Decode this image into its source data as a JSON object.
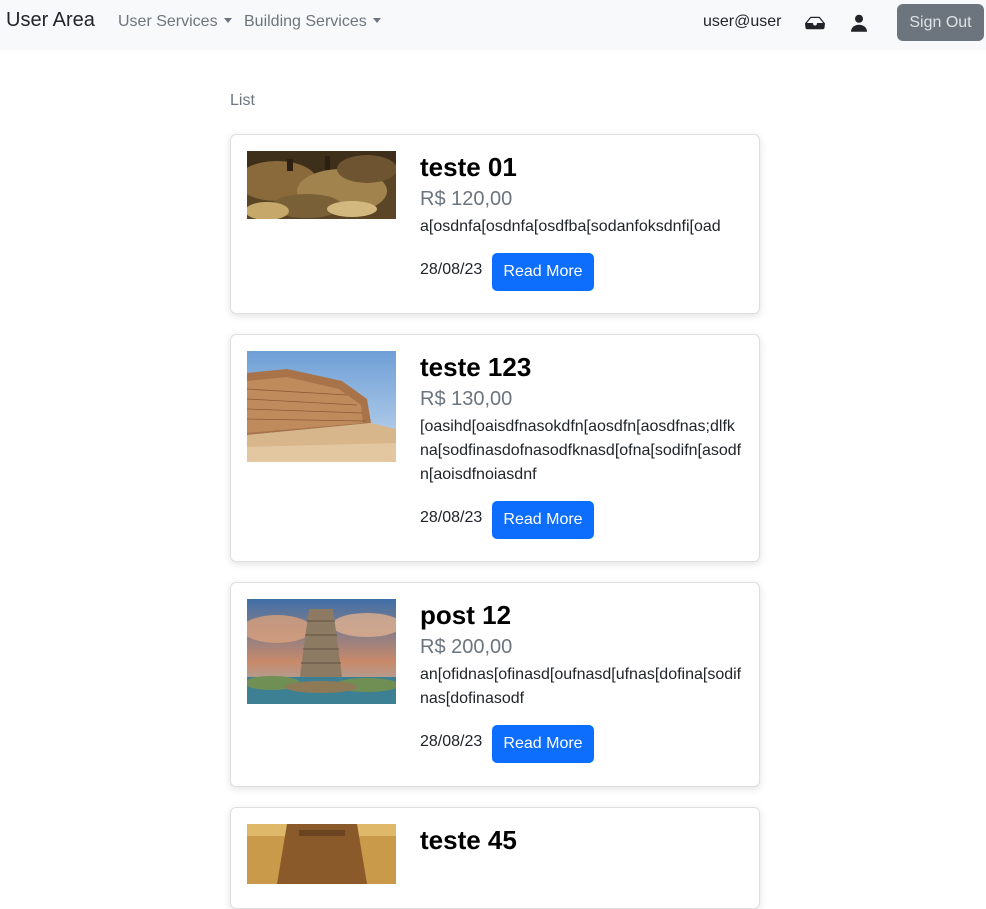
{
  "navbar": {
    "brand": "User Area",
    "user_services": "User Services",
    "building_services": "Building Services",
    "user_email": "user@user",
    "inbox_icon": "inbox-icon",
    "person_icon": "person-icon",
    "sign_out": "Sign Out"
  },
  "list": {
    "heading": "List",
    "read_more_label": "Read More",
    "items": [
      {
        "title": "teste 01",
        "price": "R$ 120,00",
        "description": "a[osdnfa[osdnfa[osdfba[sodanfoksdnfi[oad",
        "date": "28/08/23"
      },
      {
        "title": "teste 123",
        "price": "R$ 130,00",
        "description": "[oasihd[oaisdfnasokdfn[aosdfn[aosdfnas;dlfkna[sodfinasdofnasodfknasd[ofna[sodifn[asodfn[aoisdfnoiasdnf",
        "date": "28/08/23"
      },
      {
        "title": "post 12",
        "price": "R$ 200,00",
        "description": "an[ofidnas[ofinasd[oufnasd[ufnas[dofina[sodifnas[dofinasodf",
        "date": "28/08/23"
      },
      {
        "title": "teste 45"
      }
    ]
  }
}
